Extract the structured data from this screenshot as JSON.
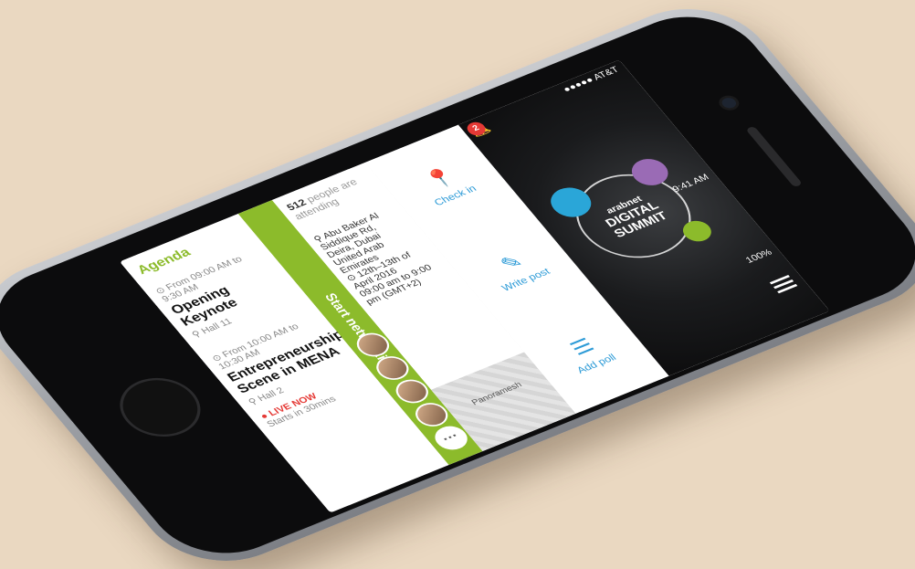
{
  "status_bar": {
    "carrier": "●●●●● AT&T",
    "time": "9:41 AM",
    "battery": "100%",
    "notification_count": "2"
  },
  "event": {
    "logo_line1": "arabnet",
    "logo_line2": "DIGITAL",
    "logo_line3": "SUMMIT",
    "dates": "12th–13th of April 2016",
    "hours": "09:00 am to 9:00 pm (GMT+2)",
    "address_line1": "Abu Baker Al Siddique Rd, Deira, Dubai",
    "address_line2": "United Arab Emirates",
    "venue_name": "Panoramesh"
  },
  "actions": {
    "check_in": "Check in",
    "write_post": "Write post",
    "add_poll": "Add poll"
  },
  "attendance": {
    "count": "512",
    "suffix": "people are attending"
  },
  "networking": {
    "label": "Start networking",
    "more": "···"
  },
  "agenda": {
    "title": "Agenda",
    "sessions": [
      {
        "time": "From 09:00 AM to 9:30 AM",
        "title": "Opening Keynote",
        "hall": "Hall 11"
      },
      {
        "time": "From 10:00 AM to 10:30 AM",
        "title": "Entrepreneurship Scene in MENA",
        "hall": "Hall 2",
        "status": "● LIVE NOW",
        "starts": "Starts in 30mins"
      }
    ]
  },
  "colors": {
    "accent_green": "#8cbb2b",
    "accent_blue": "#2d9bd7",
    "live_red": "#e53935"
  }
}
